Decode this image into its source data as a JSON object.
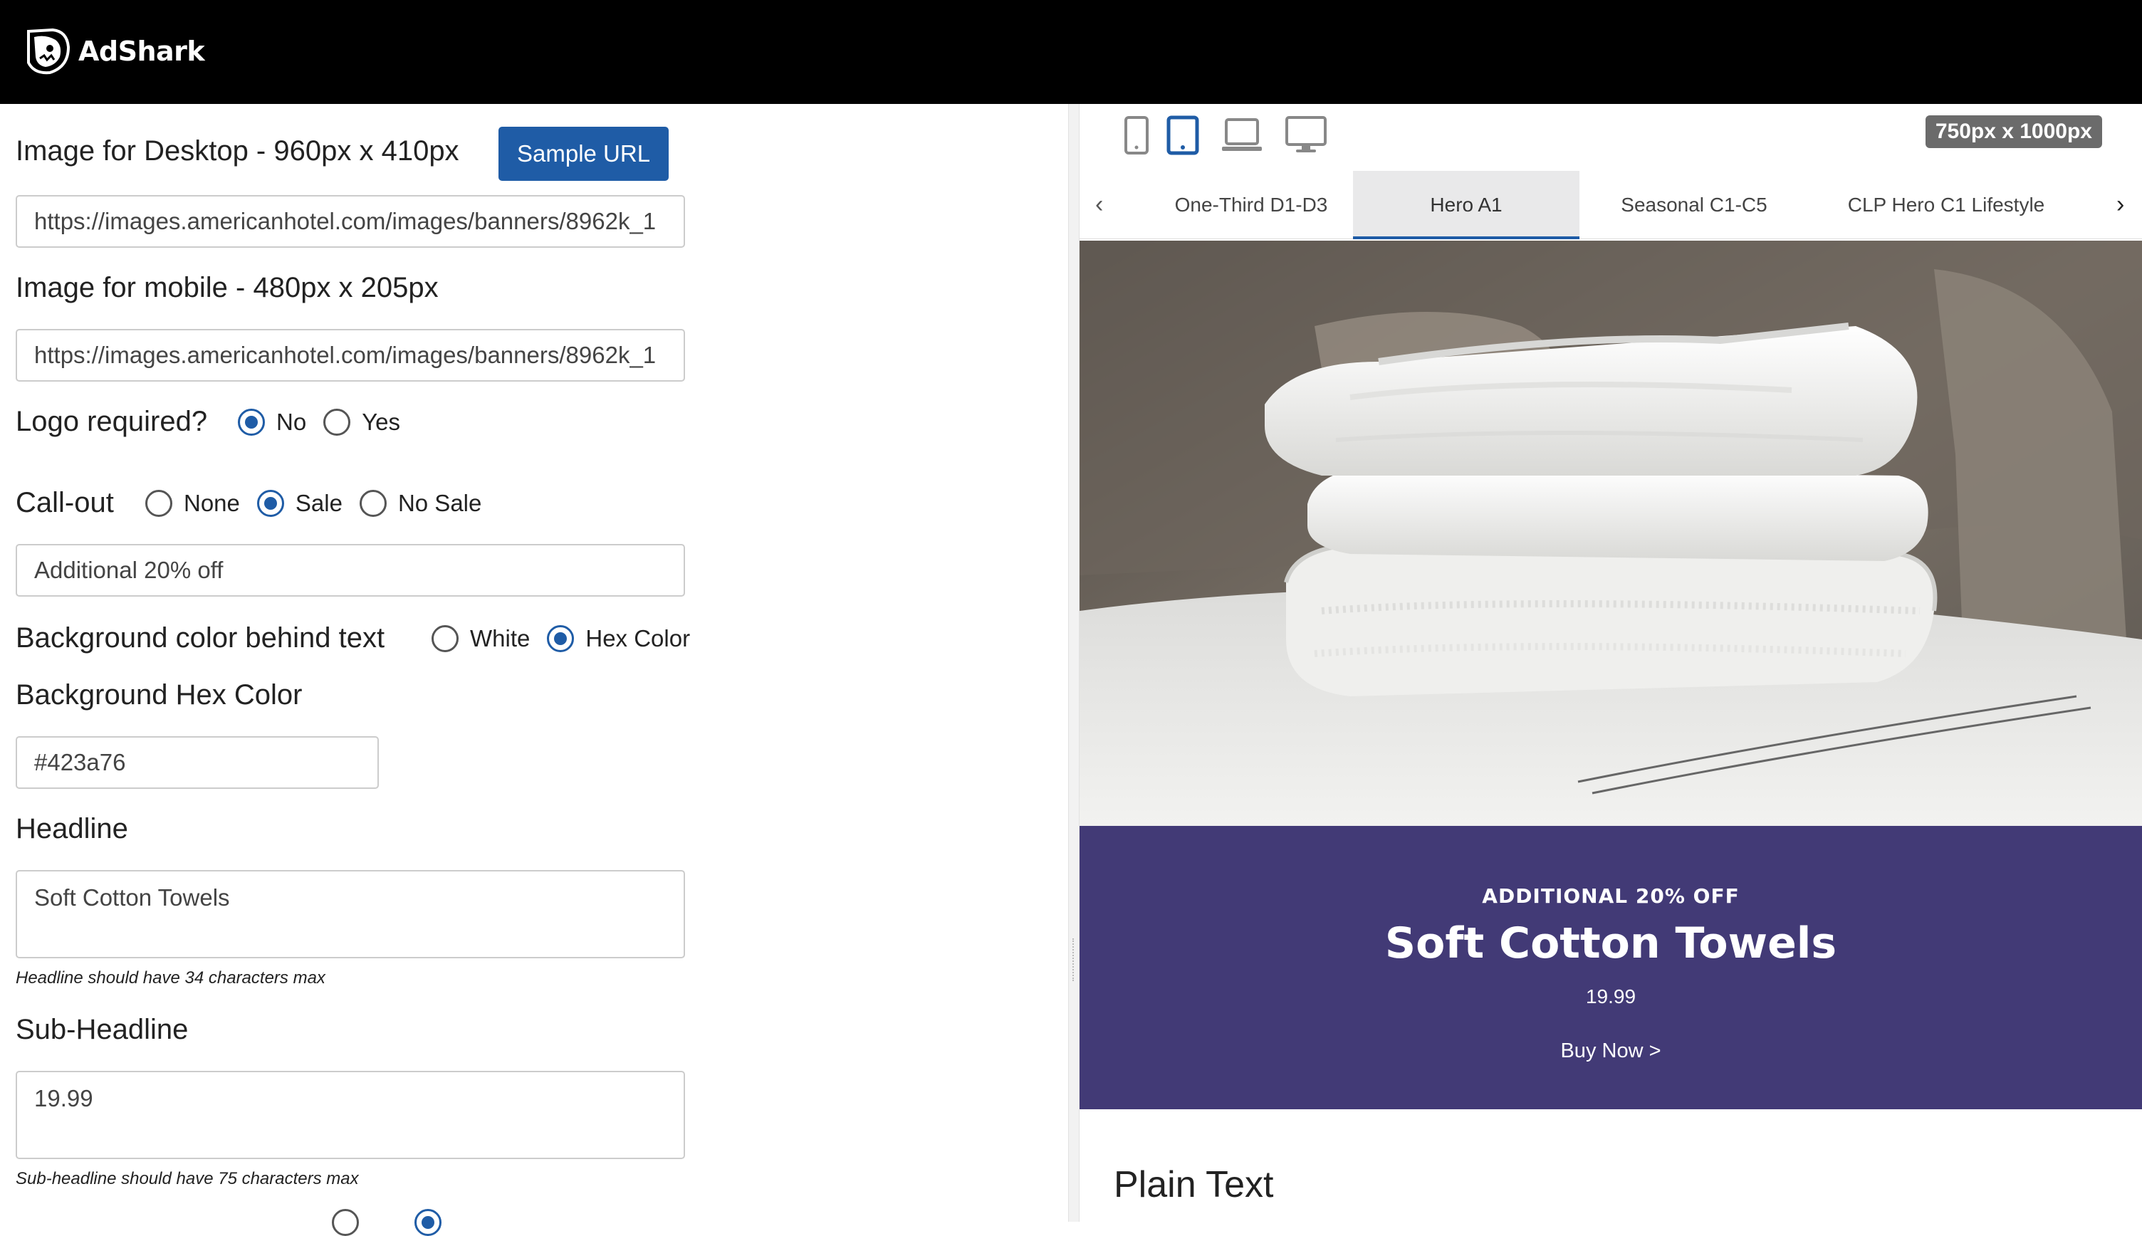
{
  "app": {
    "name": "AdShark"
  },
  "form": {
    "desktop_image": {
      "label": "Image for Desktop - 960px x 410px",
      "value": "https://images.americanhotel.com/images/banners/8962k_1",
      "sample_button": "Sample URL"
    },
    "mobile_image": {
      "label": "Image for mobile - 480px x 205px",
      "value": "https://images.americanhotel.com/images/banners/8962k_1"
    },
    "logo": {
      "label": "Logo required?",
      "options": [
        "No",
        "Yes"
      ],
      "selected": "No"
    },
    "callout": {
      "label": "Call-out",
      "options": [
        "None",
        "Sale",
        "No Sale"
      ],
      "selected": "Sale",
      "value": "Additional 20% off"
    },
    "bg_behind_text": {
      "label": "Background color behind text",
      "options": [
        "White",
        "Hex Color"
      ],
      "selected": "Hex Color"
    },
    "bg_hex": {
      "label": "Background Hex Color",
      "value": "#423a76"
    },
    "headline": {
      "label": "Headline",
      "value": "Soft Cotton Towels",
      "hint": "Headline should have 34 characters max"
    },
    "subheadline": {
      "label": "Sub-Headline",
      "value": "19.99",
      "hint": "Sub-headline should have 75 characters max"
    }
  },
  "preview": {
    "size_badge": "750px x 1000px",
    "devices": [
      "phone-icon",
      "tablet-icon",
      "laptop-icon",
      "desktop-icon"
    ],
    "active_device": "tablet-icon",
    "tabs": [
      "One-Third D1-D3",
      "Hero A1",
      "Seasonal C1-C5",
      "CLP Hero C1 Lifestyle"
    ],
    "active_tab": "Hero A1",
    "promo": {
      "callout": "ADDITIONAL 20% OFF",
      "headline": "Soft Cotton Towels",
      "sub": "19.99",
      "cta": "Buy Now >",
      "bg_color": "#423a76"
    },
    "section_title": "Plain Text"
  },
  "colors": {
    "accent": "#1f5ca6",
    "promo_bg": "#423a76"
  }
}
